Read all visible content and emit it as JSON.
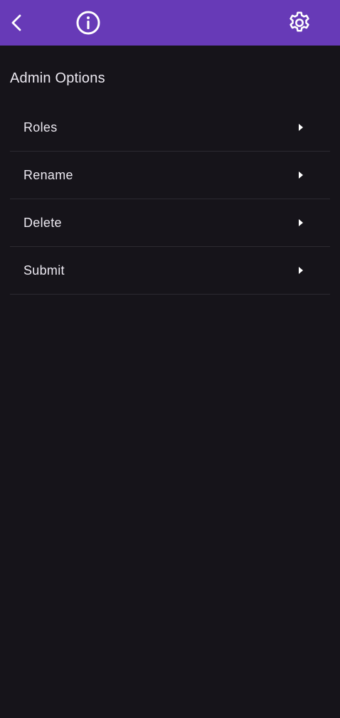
{
  "header": {
    "back_icon": "chevron-left-icon",
    "info_icon": "info-circle-icon",
    "settings_icon": "gear-icon",
    "background_color": "#673ab7"
  },
  "section": {
    "title": "Admin Options"
  },
  "menu": {
    "items": [
      {
        "label": "Roles",
        "icon": "caret-right-icon"
      },
      {
        "label": "Rename",
        "icon": "caret-right-icon"
      },
      {
        "label": "Delete",
        "icon": "caret-right-icon"
      },
      {
        "label": "Submit",
        "icon": "caret-right-icon"
      }
    ]
  },
  "colors": {
    "background": "#16141a",
    "text": "#ece9f1",
    "divider": "#2c2a31"
  }
}
